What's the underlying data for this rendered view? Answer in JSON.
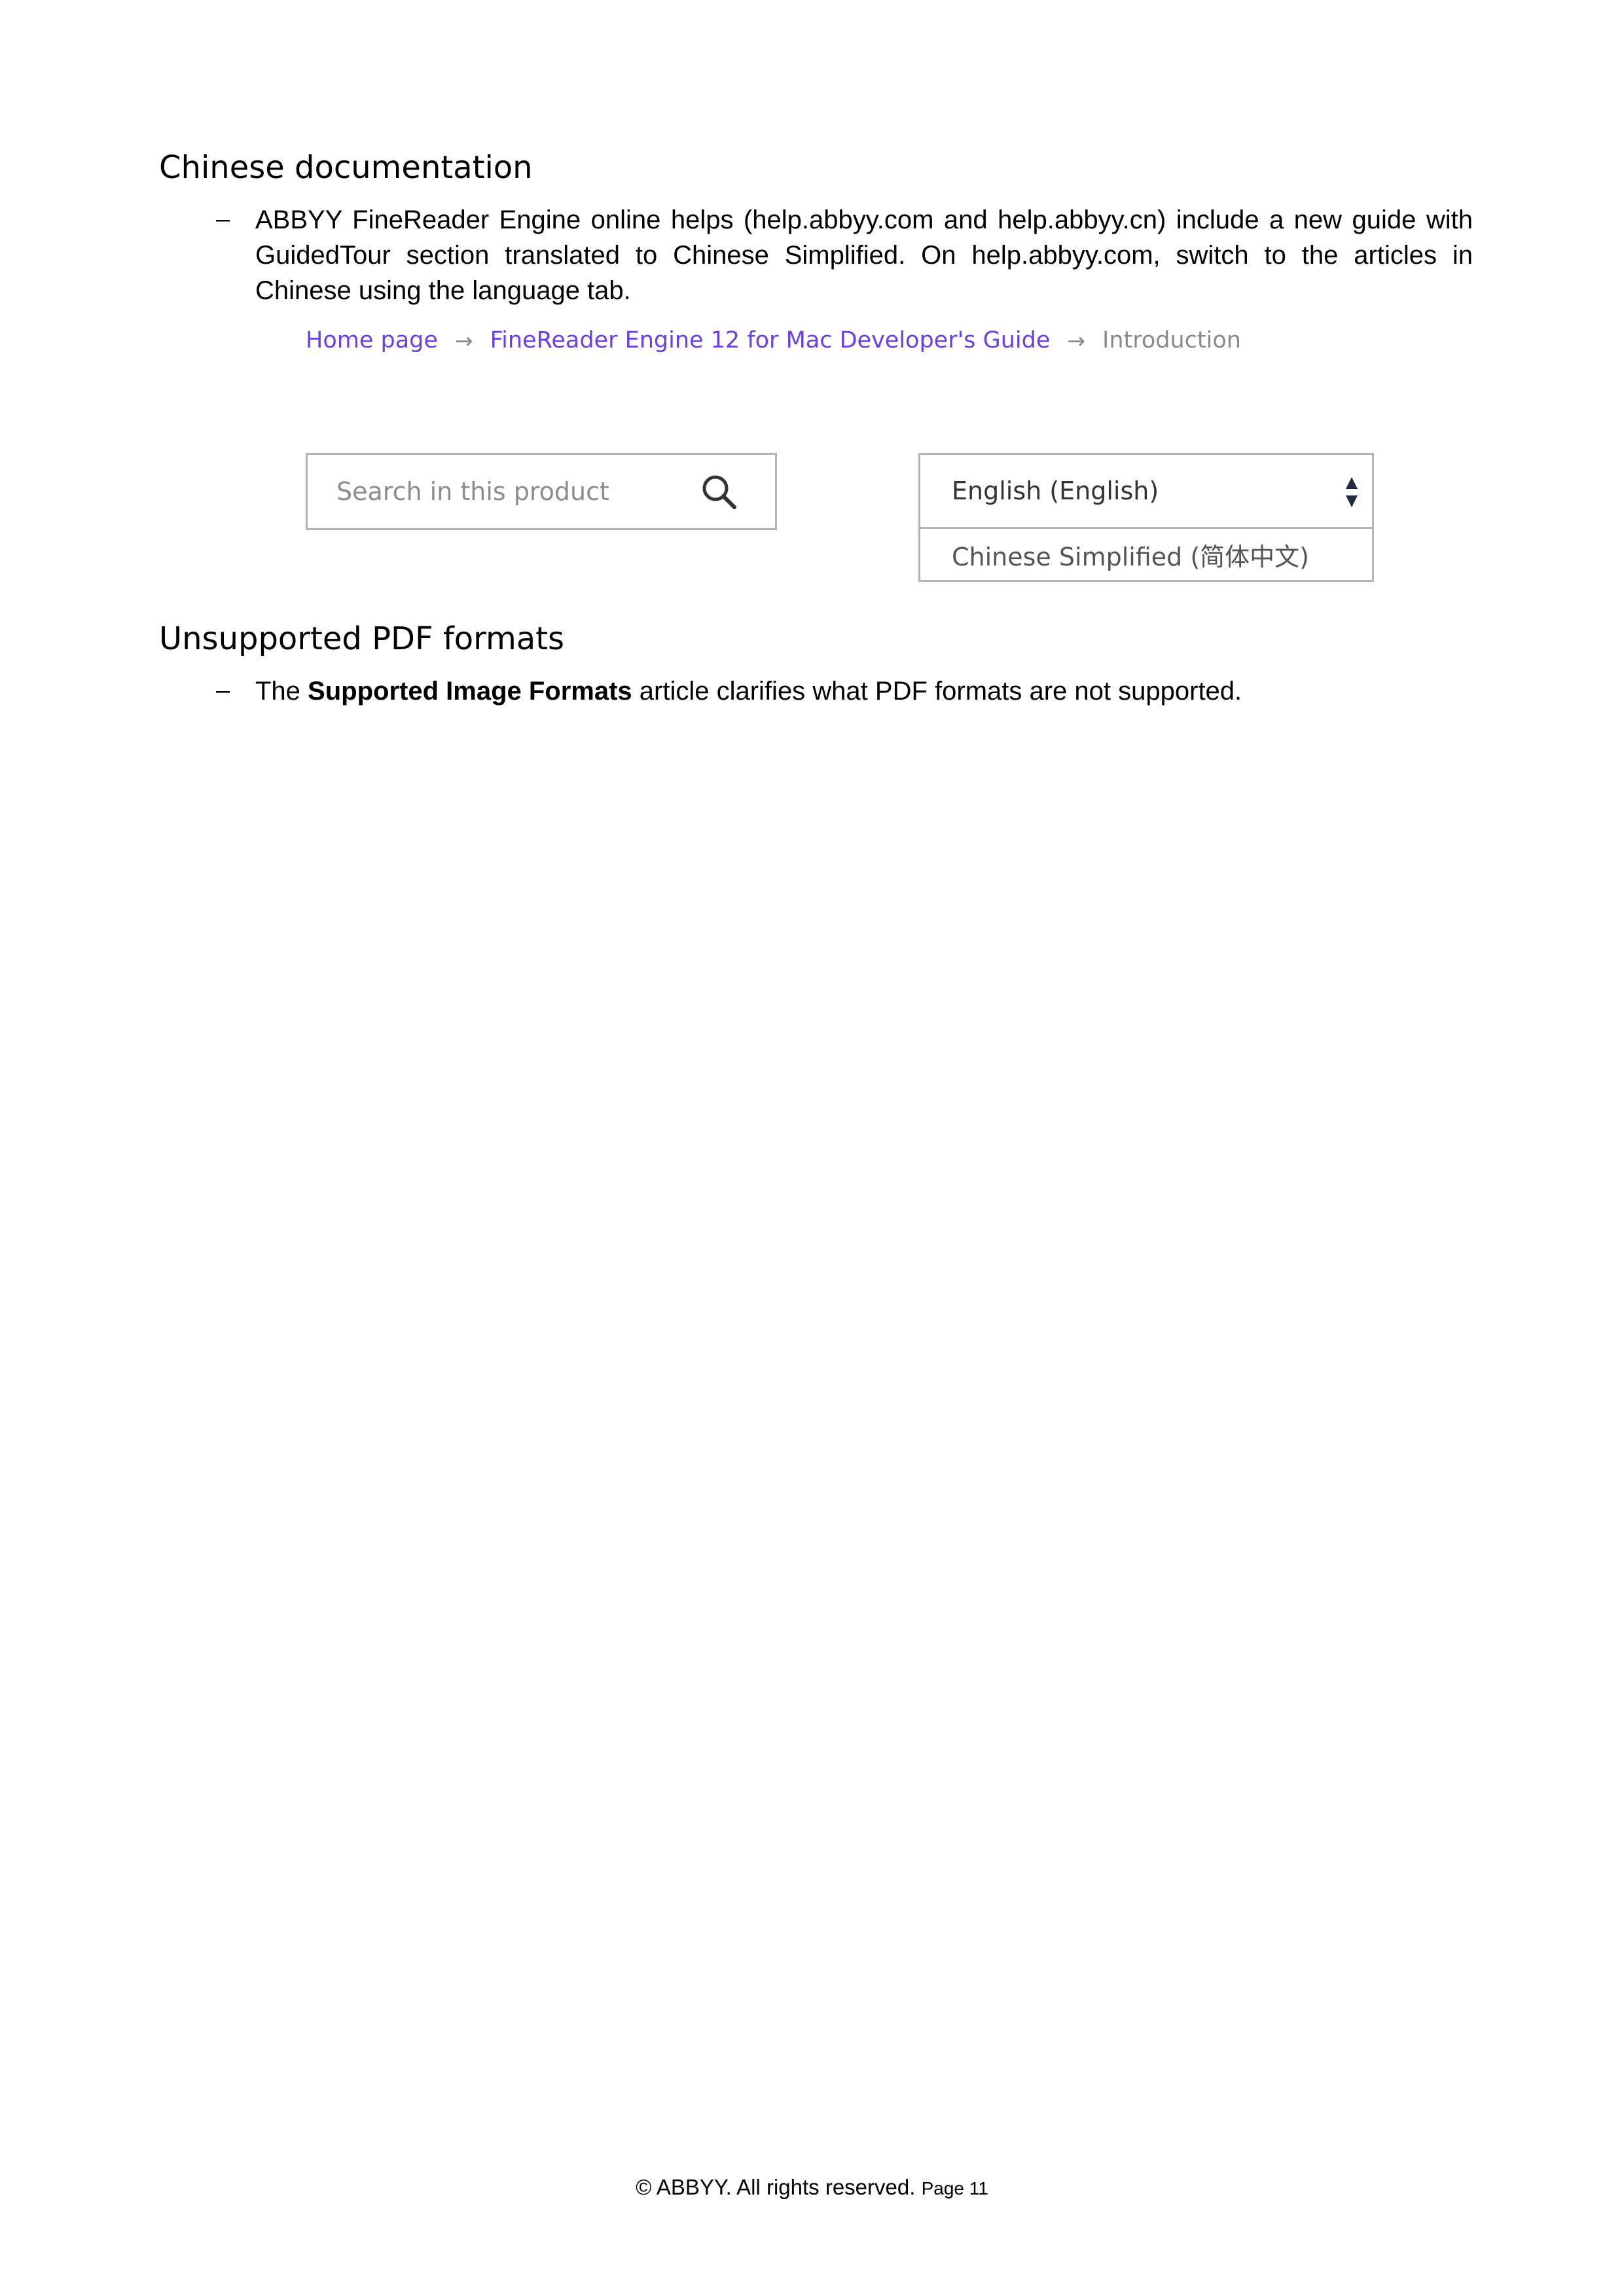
{
  "sections": [
    {
      "heading": "Chinese documentation",
      "bullet": "–",
      "paragraph": "ABBYY FineReader Engine online helps (help.abbyy.com and help.abbyy.cn) include a new guide with GuidedTour section translated to Chinese Simplified. On help.abbyy.com, switch to the articles in Chinese using the language tab."
    },
    {
      "heading": "Unsupported PDF formats",
      "bullet": "–",
      "paragraph_prefix": "The ",
      "paragraph_bold": "Supported Image Formats",
      "paragraph_suffix": " article clarifies what PDF formats are not supported."
    }
  ],
  "breadcrumb": {
    "items": [
      "Home page",
      "FineReader Engine 12 for Mac Developer's Guide",
      "Introduction"
    ],
    "separator": "→"
  },
  "search": {
    "placeholder": "Search in this product",
    "icon": "search-icon"
  },
  "language_select": {
    "selected": "English (English)",
    "options": [
      "Chinese Simplified (简体中文)"
    ],
    "icon": "sort-arrows-icon"
  },
  "colors": {
    "link": "#6b3fe6",
    "current_crumb": "#8a8a8a",
    "border": "#b4b4b4"
  },
  "footer": {
    "copyright": "© ABBYY. All rights reserved.",
    "page": "Page 11"
  }
}
